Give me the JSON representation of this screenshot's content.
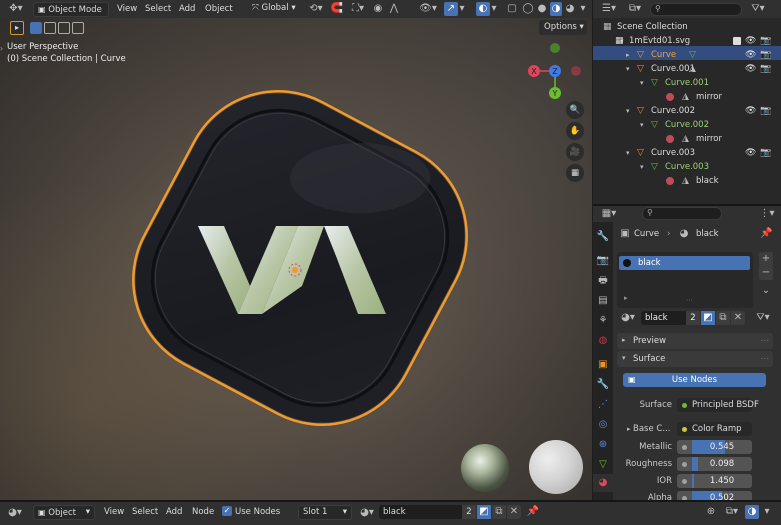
{
  "top_header": {
    "mode_label": "Object Mode",
    "menus": [
      "View",
      "Select",
      "Add",
      "Object"
    ],
    "transform_orientation": "Global",
    "options_label": "Options"
  },
  "viewport": {
    "perspective_label": "User Perspective",
    "collection_label": "(0) Scene Collection | Curve",
    "gizmo": {
      "x": "X",
      "y": "Y",
      "z": "Z"
    }
  },
  "outliner": {
    "items": [
      {
        "label": "Scene Collection"
      },
      {
        "label": "1mEvtd01.svg"
      },
      {
        "label": "Curve"
      },
      {
        "label": "Curve.001"
      },
      {
        "label": "Curve.001"
      },
      {
        "label": "mirror"
      },
      {
        "label": "Curve.002"
      },
      {
        "label": "Curve.002"
      },
      {
        "label": "mirror"
      },
      {
        "label": "Curve.003"
      },
      {
        "label": "Curve.003"
      },
      {
        "label": "black"
      }
    ]
  },
  "properties": {
    "breadcrumb": {
      "object": "Curve",
      "material": "black"
    },
    "slots": [
      {
        "label": "black"
      }
    ],
    "material_name": "black",
    "user_count": "2",
    "sections": {
      "preview": "Preview",
      "surface": "Surface"
    },
    "use_nodes_button": "Use Nodes",
    "surface_label": "Surface",
    "surface_value": "Principled BSDF",
    "base_color_label": "Base C...",
    "base_color_value": "Color Ramp",
    "params": [
      {
        "label": "Metallic",
        "value": "0.545",
        "fraction": 0.545
      },
      {
        "label": "Roughness",
        "value": "0.098",
        "fraction": 0.098
      },
      {
        "label": "IOR",
        "value": "1.450",
        "fraction": 0.0
      },
      {
        "label": "Alpha",
        "value": "0.502",
        "fraction": 0.502
      }
    ]
  },
  "bottom_header": {
    "mode_label": "Object",
    "menus": [
      "View",
      "Select",
      "Add",
      "Node"
    ],
    "use_nodes_label": "Use Nodes",
    "slot_label": "Slot 1",
    "material_name": "black",
    "user_count": "2"
  },
  "colors": {
    "accent_blue": "#4772b3",
    "selection_orange": "#f29b2c",
    "axis_x": "#e0455a",
    "axis_y": "#6bbd2f",
    "axis_z": "#3f7ce6"
  }
}
